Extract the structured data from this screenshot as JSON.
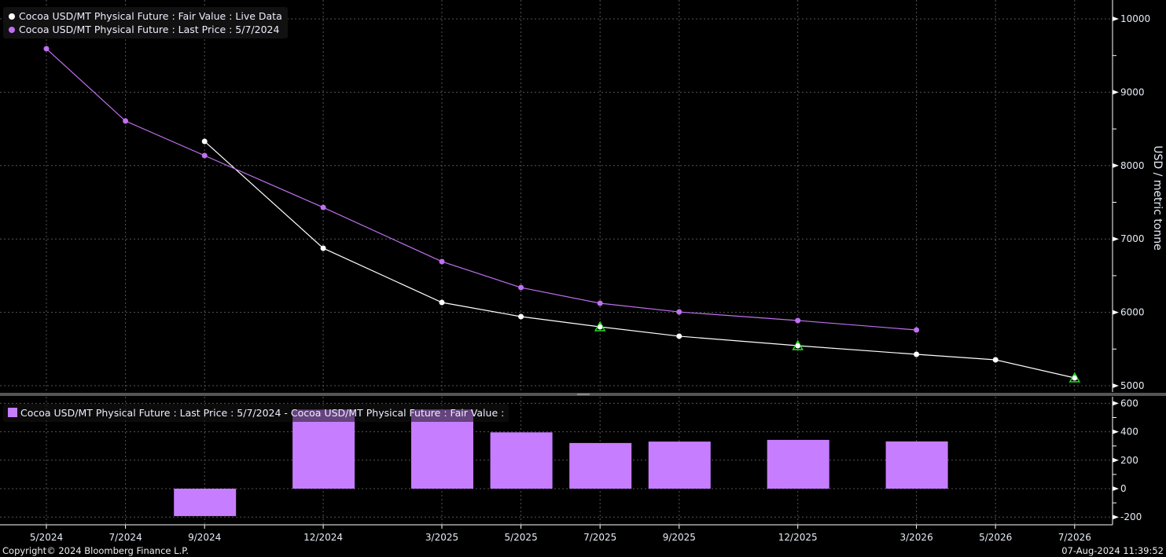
{
  "colors": {
    "fair": "#ffffff",
    "last": "#c070f0",
    "bar": "#c77dff",
    "triangle": "#22dd22"
  },
  "chart_data": [
    {
      "type": "line",
      "title": "",
      "ylabel": "USD / metric tonne",
      "ylim": [
        4900,
        10300
      ],
      "yticks": [
        5000,
        6000,
        7000,
        8000,
        9000,
        10000
      ],
      "x": [
        "5/2024",
        "7/2024",
        "9/2024",
        "12/2024",
        "3/2025",
        "5/2025",
        "7/2025",
        "9/2025",
        "12/2025",
        "3/2026",
        "5/2026",
        "7/2026"
      ],
      "x_month_index": [
        0,
        2,
        4,
        7,
        10,
        12,
        14,
        16,
        19,
        22,
        24,
        26
      ],
      "legend": [
        "Cocoa USD/MT Physical Future : Fair Value : Live Data",
        "Cocoa USD/MT Physical Future : Last Price : 5/7/2024"
      ],
      "series": [
        {
          "name": "Fair Value : Live Data",
          "values": [
            null,
            null,
            8330,
            6874,
            6135,
            5942,
            5803,
            5675,
            5546,
            5428,
            5353,
            5107
          ]
        },
        {
          "name": "Last Price : 5/7/2024",
          "values": [
            9593,
            8608,
            8137,
            7430,
            6692,
            6338,
            6124,
            6006,
            5889,
            5760,
            null,
            null
          ]
        }
      ],
      "markers_triangle_x": [
        "7/2025",
        "12/2025",
        "7/2026"
      ]
    },
    {
      "type": "bar",
      "ylim": [
        -250,
        650
      ],
      "yticks": [
        -200,
        0,
        200,
        400,
        600
      ],
      "legend": "Cocoa USD/MT Physical Future : Last Price : 5/7/2024 - Cocoa USD/MT Physical Future : Fair Value :",
      "categories": [
        "9/2024",
        "12/2024",
        "3/2025",
        "5/2025",
        "7/2025",
        "9/2025",
        "12/2025",
        "3/2026"
      ],
      "values": [
        -193,
        556,
        557,
        396,
        321,
        331,
        343,
        332
      ]
    }
  ],
  "footer": {
    "copyright": "Copyright© 2024 Bloomberg Finance L.P.",
    "timestamp": "07-Aug-2024 11:39:52"
  }
}
